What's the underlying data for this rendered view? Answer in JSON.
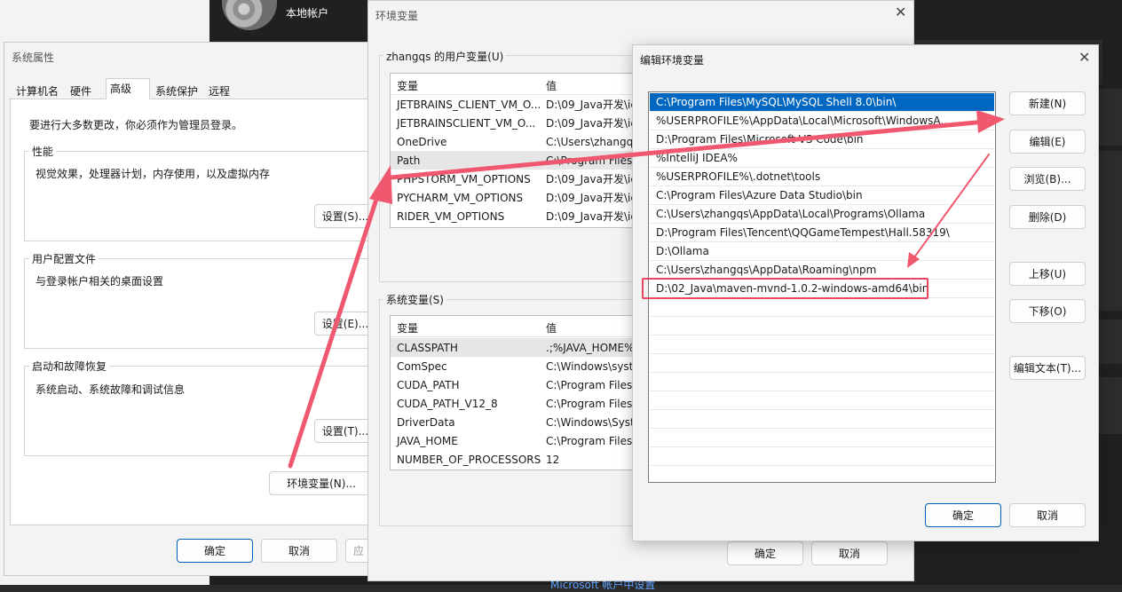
{
  "background": {
    "account_label": "本地帐户",
    "bottom_text": "Microsoft 帐户中设置"
  },
  "sysprops": {
    "title": "系统属性",
    "tabs": [
      "计算机名",
      "硬件",
      "高级",
      "系统保护",
      "远程"
    ],
    "admin_note": "要进行大多数更改，你必须作为管理员登录。",
    "perf": {
      "label": "性能",
      "desc": "视觉效果，处理器计划，内存使用，以及虚拟内存",
      "btn": "设置(S)..."
    },
    "profile": {
      "label": "用户配置文件",
      "desc": "与登录帐户相关的桌面设置",
      "btn": "设置(E)..."
    },
    "startup": {
      "label": "启动和故障恢复",
      "desc": "系统启动、系统故障和调试信息",
      "btn": "设置(T)..."
    },
    "env_btn": "环境变量(N)...",
    "ok": "确定",
    "cancel": "取消",
    "apply": "应"
  },
  "envvars": {
    "title": "环境变量",
    "user_label": "zhangqs 的用户变量(U)",
    "sys_label": "系统变量(S)",
    "col_var": "变量",
    "col_val": "值",
    "user_rows": [
      {
        "name": "JETBRAINS_CLIENT_VM_O...",
        "value": "D:\\09_Java开发\\ic"
      },
      {
        "name": "JETBRAINSCLIENT_VM_O...",
        "value": "D:\\09_Java开发\\ic"
      },
      {
        "name": "OneDrive",
        "value": "C:\\Users\\zhangq"
      },
      {
        "name": "Path",
        "value": "C:\\Program Files"
      },
      {
        "name": "PHPSTORM_VM_OPTIONS",
        "value": "D:\\09_Java开发\\ic"
      },
      {
        "name": "PYCHARM_VM_OPTIONS",
        "value": "D:\\09_Java开发\\ic"
      },
      {
        "name": "RIDER_VM_OPTIONS",
        "value": "D:\\09_Java开发\\ic"
      }
    ],
    "sys_rows": [
      {
        "name": "CLASSPATH",
        "value": ".;%JAVA_HOME%"
      },
      {
        "name": "ComSpec",
        "value": "C:\\Windows\\syst"
      },
      {
        "name": "CUDA_PATH",
        "value": "C:\\Program Files"
      },
      {
        "name": "CUDA_PATH_V12_8",
        "value": "C:\\Program Files"
      },
      {
        "name": "DriverData",
        "value": "C:\\Windows\\Syst"
      },
      {
        "name": "JAVA_HOME",
        "value": "C:\\Program Files"
      },
      {
        "name": "NUMBER_OF_PROCESSORS",
        "value": "12"
      }
    ],
    "ok": "确定",
    "cancel": "取消"
  },
  "editenv": {
    "title": "编辑环境变量",
    "paths": [
      "C:\\Program Files\\MySQL\\MySQL Shell 8.0\\bin\\",
      "%USERPROFILE%\\AppData\\Local\\Microsoft\\WindowsA...",
      "D:\\Program Files\\Microsoft VS Code\\bin",
      "%IntelliJ IDEA%",
      "%USERPROFILE%\\.dotnet\\tools",
      "C:\\Program Files\\Azure Data Studio\\bin",
      "C:\\Users\\zhangqs\\AppData\\Local\\Programs\\Ollama",
      "D:\\Program Files\\Tencent\\QQGameTempest\\Hall.58319\\",
      "D:\\Ollama",
      "C:\\Users\\zhangqs\\AppData\\Roaming\\npm",
      "D:\\02_Java\\maven-mvnd-1.0.2-windows-amd64\\bin"
    ],
    "new": "新建(N)",
    "edit": "编辑(E)",
    "browse": "浏览(B)...",
    "delete": "删除(D)",
    "up": "上移(U)",
    "down": "下移(O)",
    "edit_text": "编辑文本(T)...",
    "ok": "确定",
    "cancel": "取消"
  },
  "colors": {
    "accent": "#0067c0",
    "annotation": "#e94560"
  }
}
